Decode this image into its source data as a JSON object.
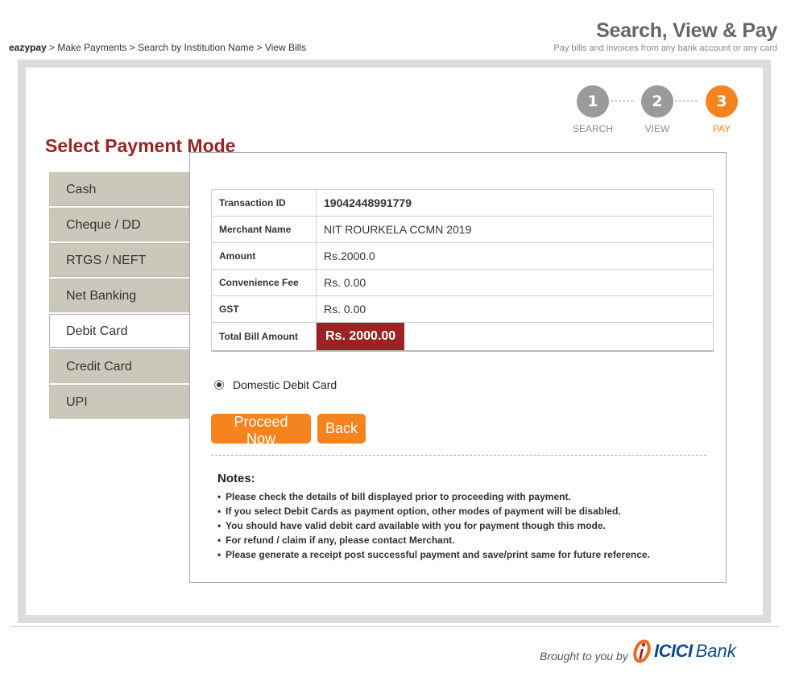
{
  "breadcrumb": {
    "home": "eazypay",
    "trail": " > Make Payments > Search by Institution Name > View Bills"
  },
  "brand": {
    "title": "Search, View & Pay",
    "subtitle": "Pay bills and invoices from any bank account or any card"
  },
  "steps": [
    {
      "number": "1",
      "label": "SEARCH",
      "active": false
    },
    {
      "number": "2",
      "label": "VIEW",
      "active": false
    },
    {
      "number": "3",
      "label": "PAY",
      "active": true
    }
  ],
  "page_title": "Select Payment Mode",
  "payment_modes": [
    {
      "label": "Cash",
      "active": false
    },
    {
      "label": "Cheque / DD",
      "active": false
    },
    {
      "label": "RTGS / NEFT",
      "active": false
    },
    {
      "label": "Net Banking",
      "active": false
    },
    {
      "label": "Debit Card",
      "active": true
    },
    {
      "label": "Credit Card",
      "active": false
    },
    {
      "label": "UPI",
      "active": false
    }
  ],
  "details": {
    "transaction_id_label": "Transaction ID",
    "transaction_id": "19042448991779",
    "merchant_label": "Merchant Name",
    "merchant": "NIT ROURKELA CCMN 2019",
    "amount_label": "Amount",
    "amount": "Rs.2000.0",
    "fee_label": "Convenience Fee",
    "fee": "Rs. 0.00",
    "gst_label": "GST",
    "gst": "Rs. 0.00",
    "total_label": "Total Bill Amount",
    "total": "Rs. 2000.00"
  },
  "card_option": "Domestic Debit Card",
  "buttons": {
    "proceed": "Proceed Now",
    "back": "Back"
  },
  "notes": {
    "title": "Notes:",
    "items": [
      "Please check the details of bill displayed prior to proceeding with payment.",
      "If you select Debit Cards as payment option, other modes of payment will be disabled.",
      "You should have valid debit card available with you for payment though this mode.",
      "For refund / claim if any, please contact Merchant.",
      "Please generate a receipt post successful payment and save/print same for future reference."
    ]
  },
  "footer": {
    "brought_by": "Brought to you by",
    "bank_name_1": "ICICI",
    "bank_name_2": "Bank"
  },
  "colors": {
    "accent": "#f5841f",
    "brand_red": "#9b2323",
    "tab_bg": "#cbc8bb"
  }
}
